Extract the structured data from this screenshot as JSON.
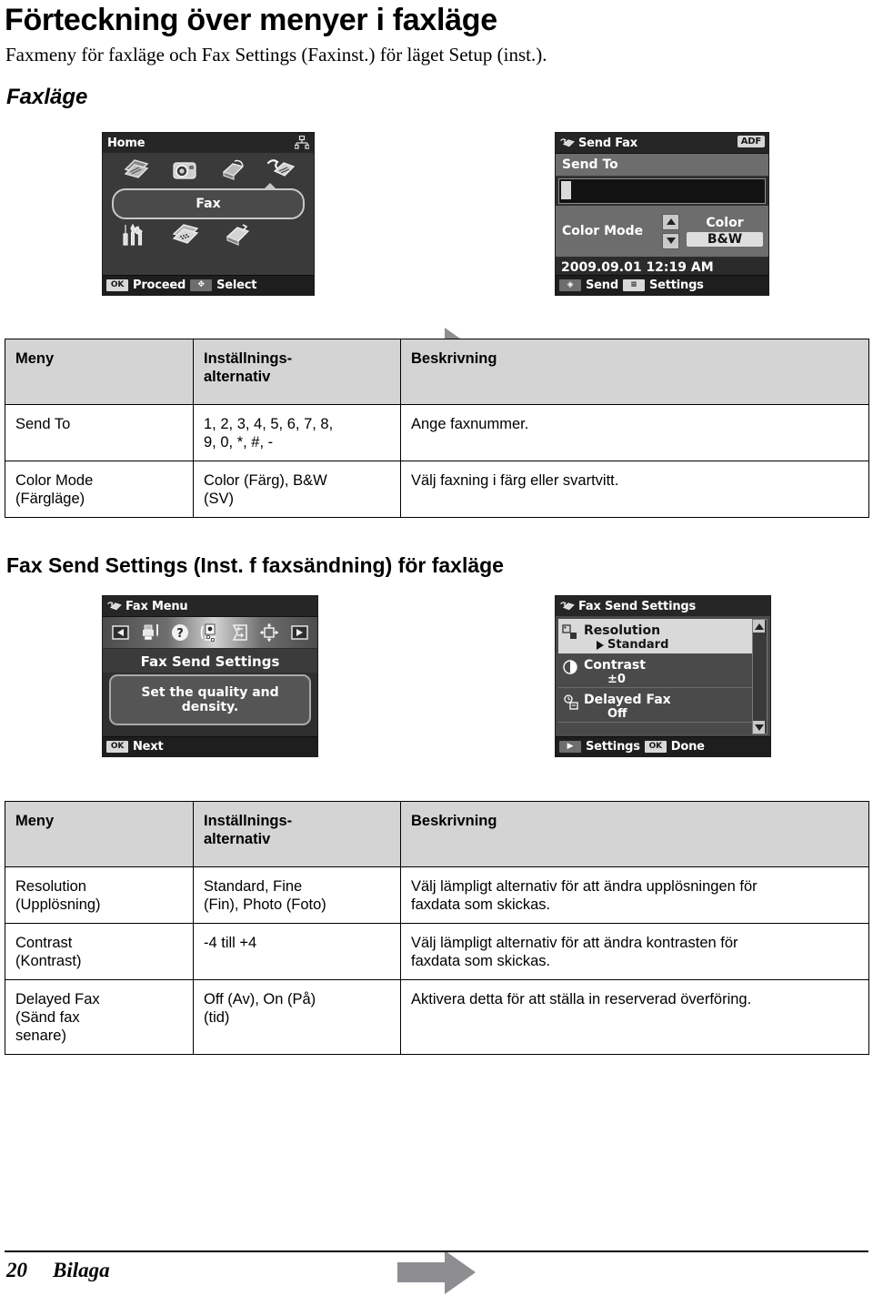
{
  "document": {
    "title": "Förteckning över menyer i faxläge",
    "subtitle": "Faxmeny för faxläge och Fax Settings (Faxinst.) för läget Setup (inst.).",
    "section_1_heading": "Faxläge",
    "section_2_heading": "Fax Send Settings (Inst. f faxsändning) för faxläge",
    "footer": {
      "page_number": "20",
      "section_name": "Bilaga"
    },
    "arrow_color": "#8d8d92"
  },
  "screens": {
    "home": {
      "title": "Home",
      "network_icon": "network-icon",
      "top_icons": [
        "copy-icon",
        "photo-icon",
        "scan-icon",
        "fax-icon"
      ],
      "bottom_icons": [
        "setup-icon",
        "copy-layout-icon",
        "maintenance-icon"
      ],
      "selected_label": "Fax",
      "footer_key_1": "OK",
      "footer_label_1": "Proceed",
      "footer_key_2": "✥",
      "footer_label_2": "Select"
    },
    "send_fax": {
      "title": "Send Fax",
      "title_icon": "fax-icon",
      "adf_badge": "ADF",
      "send_to_label": "Send To",
      "send_to_value": "",
      "color_mode_label": "Color Mode",
      "color_option_1": "Color",
      "color_option_2": "B&W",
      "selected_color_option": "B&W",
      "datetime": "2009.09.01  12:19 AM",
      "footer_key_1": "◈",
      "footer_label_1": "Send",
      "footer_key_2": "≡",
      "footer_label_2": "Settings"
    },
    "fax_menu": {
      "title": "Fax Menu",
      "title_icon": "fax-icon",
      "strip_icons": [
        "arrow-left-icon",
        "print-report-icon",
        "help-icon",
        "fax-send-settings-icon",
        "fax-communication-icon",
        "nozzle-check-icon",
        "arrow-right-icon"
      ],
      "heading": "Fax Send Settings",
      "description": "Set the quality and density.",
      "footer_key_1": "OK",
      "footer_label_1": "Next"
    },
    "fax_send_settings": {
      "title": "Fax Send Settings",
      "title_icon": "fax-icon",
      "rows": [
        {
          "icon": "resolution-icon",
          "name": "Resolution",
          "value": "Standard",
          "selected": true,
          "has_arrow": true
        },
        {
          "icon": "contrast-icon",
          "name": "Contrast",
          "value": "±0",
          "selected": false,
          "has_arrow": false
        },
        {
          "icon": "delayed-fax-icon",
          "name": "Delayed Fax",
          "value": "Off",
          "selected": false,
          "has_arrow": false
        }
      ],
      "scroll_up": "▲",
      "scroll_down": "▼",
      "footer_key_1": "▶",
      "footer_label_1": "Settings",
      "footer_key_2": "OK",
      "footer_label_2": "Done"
    }
  },
  "table_fax_mode": {
    "headers": {
      "col1": "Meny",
      "col2_line1": "Inställnings-",
      "col2_line2": "alternativ",
      "col3": "Beskrivning"
    },
    "rows": [
      {
        "menu_line1": "Send To",
        "menu_line2": "",
        "menu_line3": "",
        "options_line1": "1, 2, 3, 4, 5, 6, 7, 8,",
        "options_line2": "9, 0, *, #, -",
        "description_line1": "Ange faxnummer.",
        "description_line2": ""
      },
      {
        "menu_line1": "Color Mode",
        "menu_line2": "(Färgläge)",
        "menu_line3": "",
        "options_line1": "Color (Färg), B&W",
        "options_line2": "(SV)",
        "description_line1": "Välj faxning i färg eller svartvitt.",
        "description_line2": ""
      }
    ]
  },
  "table_fax_send_settings": {
    "headers": {
      "col1": "Meny",
      "col2_line1": "Inställnings-",
      "col2_line2": "alternativ",
      "col3": "Beskrivning"
    },
    "rows": [
      {
        "menu_line1": "Resolution",
        "menu_line2": "(Upplösning)",
        "menu_line3": "",
        "options_line1": "Standard, Fine",
        "options_line2": "(Fin), Photo (Foto)",
        "description_line1": "Välj lämpligt alternativ för att ändra upplösningen för",
        "description_line2": "faxdata som skickas."
      },
      {
        "menu_line1": "Contrast",
        "menu_line2": "(Kontrast)",
        "menu_line3": "",
        "options_line1": "-4 till +4",
        "options_line2": "",
        "description_line1": "Välj lämpligt alternativ för att ändra kontrasten för",
        "description_line2": "faxdata som skickas."
      },
      {
        "menu_line1": "Delayed Fax",
        "menu_line2": "(Sänd fax",
        "menu_line3": "senare)",
        "options_line1": "Off (Av), On (På)",
        "options_line2": "(tid)",
        "description_line1": "Aktivera detta för att ställa in reserverad överföring.",
        "description_line2": ""
      }
    ]
  }
}
